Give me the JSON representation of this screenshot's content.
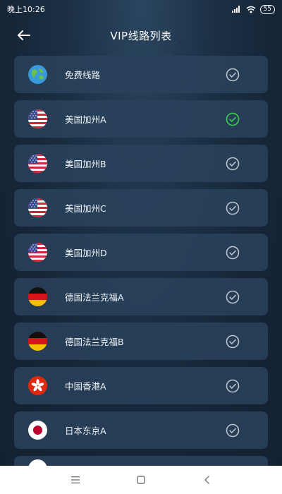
{
  "status_bar": {
    "time": "晚上10:26",
    "battery": "55"
  },
  "header": {
    "title": "VIP线路列表"
  },
  "routes": [
    {
      "label": "免费线路",
      "flag": "globe",
      "selected": false
    },
    {
      "label": "美国加州A",
      "flag": "us",
      "selected": true
    },
    {
      "label": "美国加州B",
      "flag": "us",
      "selected": false
    },
    {
      "label": "美国加州C",
      "flag": "us",
      "selected": false
    },
    {
      "label": "美国加州D",
      "flag": "us",
      "selected": false
    },
    {
      "label": "德国法兰克福A",
      "flag": "de",
      "selected": false
    },
    {
      "label": "德国法兰克福B",
      "flag": "de",
      "selected": false
    },
    {
      "label": "中国香港A",
      "flag": "hk",
      "selected": false
    },
    {
      "label": "日本东京A",
      "flag": "jp",
      "selected": false
    }
  ],
  "colors": {
    "selected_check": "#3ccf4e",
    "unselected_check": "#b8c2cc"
  }
}
